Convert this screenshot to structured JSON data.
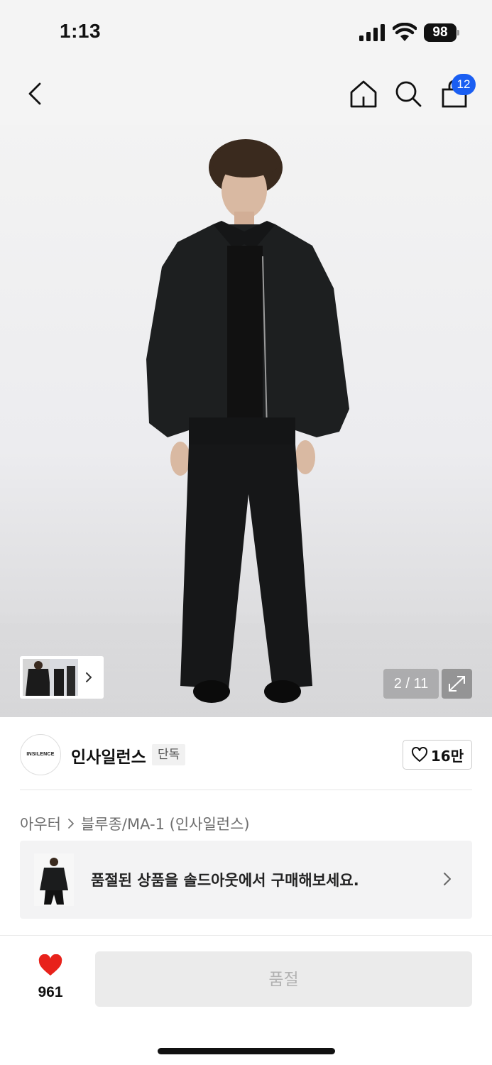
{
  "status_bar": {
    "time": "1:13",
    "battery": "98"
  },
  "nav": {
    "cart_count": "12"
  },
  "hero": {
    "page_counter": "2 / 11"
  },
  "brand": {
    "logo_text": "INSILENCE",
    "name": "인사일런스",
    "tag": "단독",
    "likes": "16만"
  },
  "breadcrumb": {
    "category": "아우터",
    "subcategory": "블루종/MA-1 (인사일런스)"
  },
  "soldout_banner": {
    "text": "품절된 상품을 솔드아웃에서 구매해보세요."
  },
  "bottom_bar": {
    "wish_count": "961",
    "buy_label": "품절"
  },
  "colors": {
    "accent_blue": "#1a5ef2",
    "heart_red": "#e8221b",
    "disabled_gray": "#ebebeb"
  },
  "icons": [
    "back-icon",
    "home-icon",
    "search-icon",
    "shopping-bag-icon",
    "expand-icon",
    "chevron-right-icon",
    "heart-outline-icon",
    "heart-filled-icon"
  ]
}
